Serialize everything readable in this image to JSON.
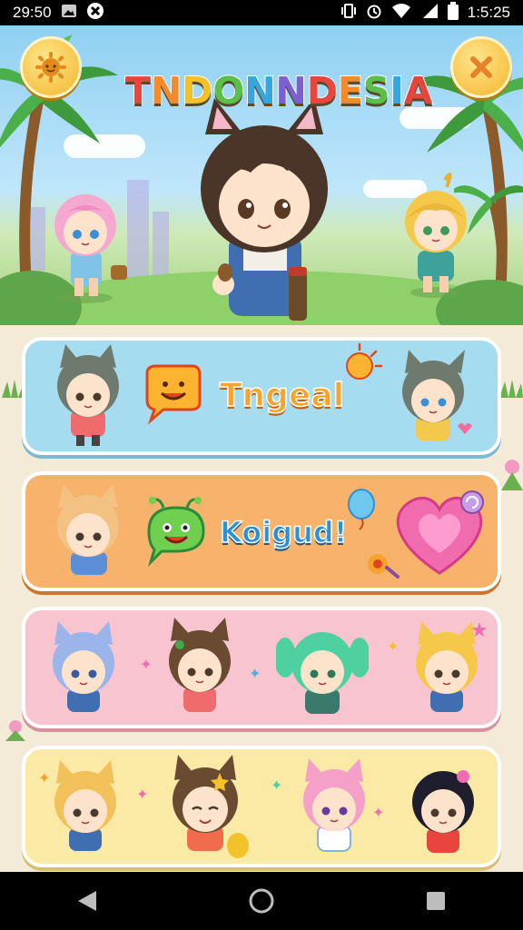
{
  "status_bar": {
    "time": "29:50",
    "clock": "1:5:25"
  },
  "header": {
    "title": "TNDONNDESIA",
    "title_letter_colors": [
      "#e8453c",
      "#f58a2a",
      "#f3c12a",
      "#5bbf4a",
      "#35a6e0",
      "#7b5fd6",
      "#e8453c",
      "#f58a2a",
      "#5bbf4a",
      "#35a6e0",
      "#e8453c"
    ]
  },
  "cards": [
    {
      "label": "Tngeal",
      "background": "#a6dcef",
      "border": "#ffffff"
    },
    {
      "label": "Koigud!",
      "background": "#f7b36b",
      "border": "#ffffff"
    },
    {
      "label": "",
      "background": "#f7c4cf",
      "border": "#ffffff"
    },
    {
      "label": "",
      "background": "#fbe9a6",
      "border": "#ffffff"
    }
  ],
  "icons": {
    "settings": "sun-gear-icon",
    "close": "close-icon",
    "nav_back": "back-triangle-icon",
    "nav_home": "home-circle-icon",
    "nav_recents": "recents-square-icon"
  },
  "colors": {
    "accent_gold": "#f4b62e",
    "close_x": "#e8822a"
  }
}
